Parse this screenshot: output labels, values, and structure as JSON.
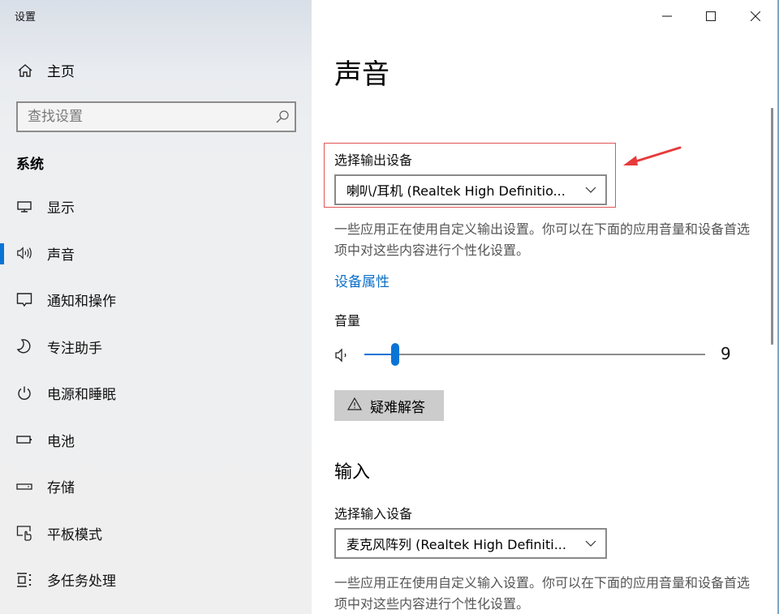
{
  "window": {
    "app_title": "设置",
    "controls": {
      "minimize": "minimize-icon",
      "maximize": "maximize-icon",
      "close": "close-icon"
    }
  },
  "sidebar": {
    "home": {
      "label": "主页",
      "icon": "home-icon"
    },
    "search": {
      "placeholder": "查找设置",
      "value": "",
      "icon": "search-icon"
    },
    "section": "系统",
    "items": [
      {
        "label": "显示",
        "icon": "monitor-icon",
        "active": false
      },
      {
        "label": "声音",
        "icon": "speaker-icon",
        "active": true
      },
      {
        "label": "通知和操作",
        "icon": "notification-icon",
        "active": false
      },
      {
        "label": "专注助手",
        "icon": "moon-icon",
        "active": false
      },
      {
        "label": "电源和睡眠",
        "icon": "power-icon",
        "active": false
      },
      {
        "label": "电池",
        "icon": "battery-icon",
        "active": false
      },
      {
        "label": "存储",
        "icon": "storage-icon",
        "active": false
      },
      {
        "label": "平板模式",
        "icon": "tablet-mode-icon",
        "active": false
      },
      {
        "label": "多任务处理",
        "icon": "multitasking-icon",
        "active": false
      }
    ]
  },
  "main": {
    "title": "声音",
    "output": {
      "label": "选择输出设备",
      "selected": "喇叭/耳机 (Realtek High Definitio...",
      "description": "一些应用正在使用自定义输出设置。你可以在下面的应用音量和设备首选项中对这些内容进行个性化设置。",
      "device_properties_link": "设备属性",
      "volume_label": "音量",
      "volume_value": 9,
      "volume_max": 100,
      "volume_display": "9",
      "troubleshoot_label": "疑难解答"
    },
    "input": {
      "heading": "输入",
      "label": "选择输入设备",
      "selected": "麦克风阵列 (Realtek High Definiti...",
      "description": "一些应用正在使用自定义输入设置。你可以在下面的应用音量和设备首选项中对这些内容进行个性化设置。"
    }
  },
  "colors": {
    "accent": "#0a74d4",
    "link": "#0a6fc7",
    "annotation": "#e83a3a"
  }
}
